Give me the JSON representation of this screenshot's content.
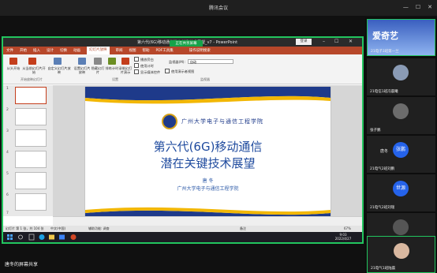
{
  "meeting": {
    "title": "腾讯会议"
  },
  "powerpoint": {
    "window_title": "第六代(6G)移动通信潜在关键技术展望_v7 - PowerPoint",
    "sign_in": "登录",
    "share_badge": "正在共享屏幕",
    "tabs": [
      "文件",
      "开始",
      "插入",
      "设计",
      "切换",
      "动画",
      "幻灯片放映",
      "审阅",
      "视图",
      "帮助",
      "PDF工具集"
    ],
    "active_tab": "幻灯片放映",
    "tell_me": "操作说明搜索",
    "ribbon": {
      "from_start": "从头开始",
      "from_current": "从当前幻灯片开始",
      "custom_show": "自定义幻灯片放映",
      "setup": "设置幻灯片放映",
      "hide_slide": "隐藏幻灯片",
      "rehearse": "排练计时",
      "record": "录制幻灯片演示",
      "check_narration": "播放旁白",
      "check_timing": "使用计时",
      "check_media": "显示媒体控件",
      "monitor_label": "监视器(M):",
      "monitor_value": "自动",
      "presenter_view": "使用演示者视图",
      "group_start": "开始放映幻灯片",
      "group_setup": "设置",
      "group_monitor": "监视器"
    },
    "thumbnails": [
      "1",
      "2",
      "3",
      "4",
      "5",
      "6",
      "7"
    ],
    "slide": {
      "school": "广州大学电子与通信工程学院",
      "title_line1": "第六代(6G)移动通信",
      "title_line2": "潜在关键技术展望",
      "author": "唐 冬",
      "affiliation": "广州大学电子与通信工程学院"
    },
    "status": {
      "slide_info": "幻灯片 第 1 张，共 104 张",
      "language": "中文(中国)",
      "accessibility": "辅助功能: 调查",
      "notes": "备注",
      "zoom": "67%"
    },
    "clock": {
      "time": "9:03",
      "date": "2022/4/27"
    }
  },
  "presenter_name": "唐冬的屏幕共享",
  "participants": [
    {
      "name": "21电子3班第一兰",
      "brand": "爱奇艺",
      "avatar": ""
    },
    {
      "name": "21电信1班冯晨曦",
      "brand": "",
      "avatar": ""
    },
    {
      "name": "张子鹏",
      "brand": "",
      "avatar": ""
    },
    {
      "name": "21电气2班刘鹏",
      "brand": "",
      "avatar": "张鹏"
    },
    {
      "name": "21电气2班刘瑞",
      "brand": "",
      "avatar": "世源"
    },
    {
      "name": "王诗语",
      "brand": "",
      "avatar": ""
    },
    {
      "name": "21电气1班陆晨",
      "brand": "",
      "avatar": ""
    }
  ],
  "self_label": "唐冬"
}
